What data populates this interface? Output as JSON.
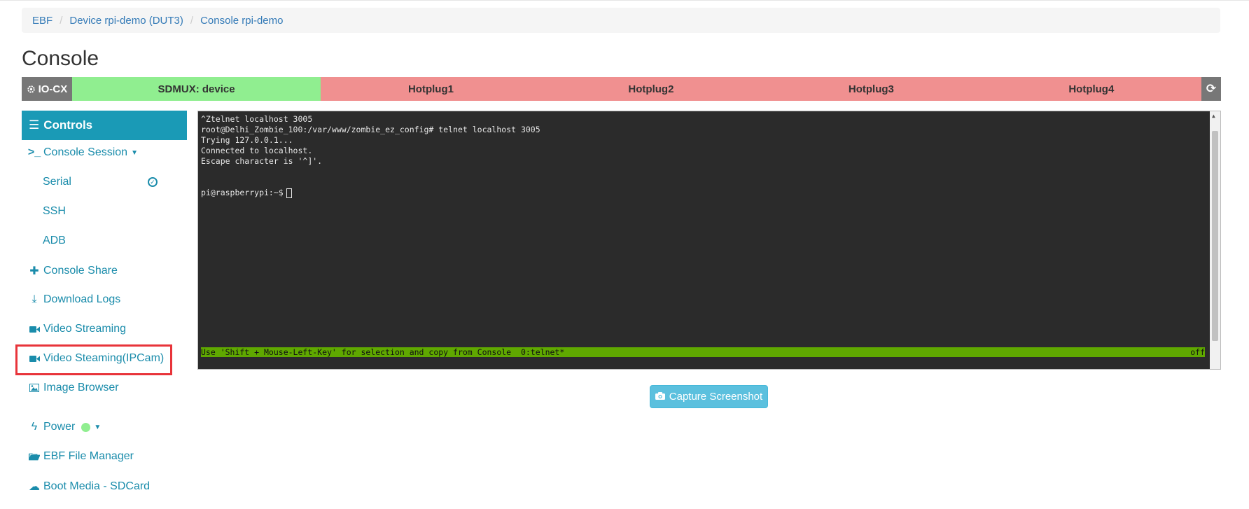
{
  "breadcrumb": {
    "item1": "EBF",
    "item2": "Device rpi-demo (DUT3)",
    "item3": "Console rpi-demo"
  },
  "page": {
    "title": "Console"
  },
  "status_bar": {
    "iocx": "IO-CX",
    "sdmux": "SDMUX: device",
    "hotplug1": "Hotplug1",
    "hotplug2": "Hotplug2",
    "hotplug3": "Hotplug3",
    "hotplug4": "Hotplug4",
    "colors": {
      "sdmux": "#90ee90",
      "hotplug": "#f09090",
      "iocx": "#777777"
    }
  },
  "sidebar": {
    "header": "Controls",
    "console_session": "Console Session",
    "serial": "Serial",
    "ssh": "SSH",
    "adb": "ADB",
    "console_share": "Console Share",
    "download_logs": "Download Logs",
    "video_streaming": "Video Streaming",
    "video_ipcam": "Video Steaming(IPCam)",
    "image_browser": "Image Browser",
    "power": "Power",
    "file_manager": "EBF File Manager",
    "boot_media": "Boot Media - SDCard"
  },
  "terminal": {
    "line1": "^Ztelnet localhost 3005",
    "line2": "root@Delhi_Zombie_100:/var/www/zombie_ez_config# telnet localhost 3005",
    "line3": "Trying 127.0.0.1...",
    "line4": "Connected to localhost.",
    "line5": "Escape character is '^]'.",
    "prompt": "pi@raspberrypi:~$",
    "status_left": "Use 'Shift + Mouse-Left-Key' for selection and copy from Console  0:telnet*",
    "status_right": "off"
  },
  "capture": {
    "label": "Capture Screenshot"
  },
  "accent_color": "#1a9ab6"
}
